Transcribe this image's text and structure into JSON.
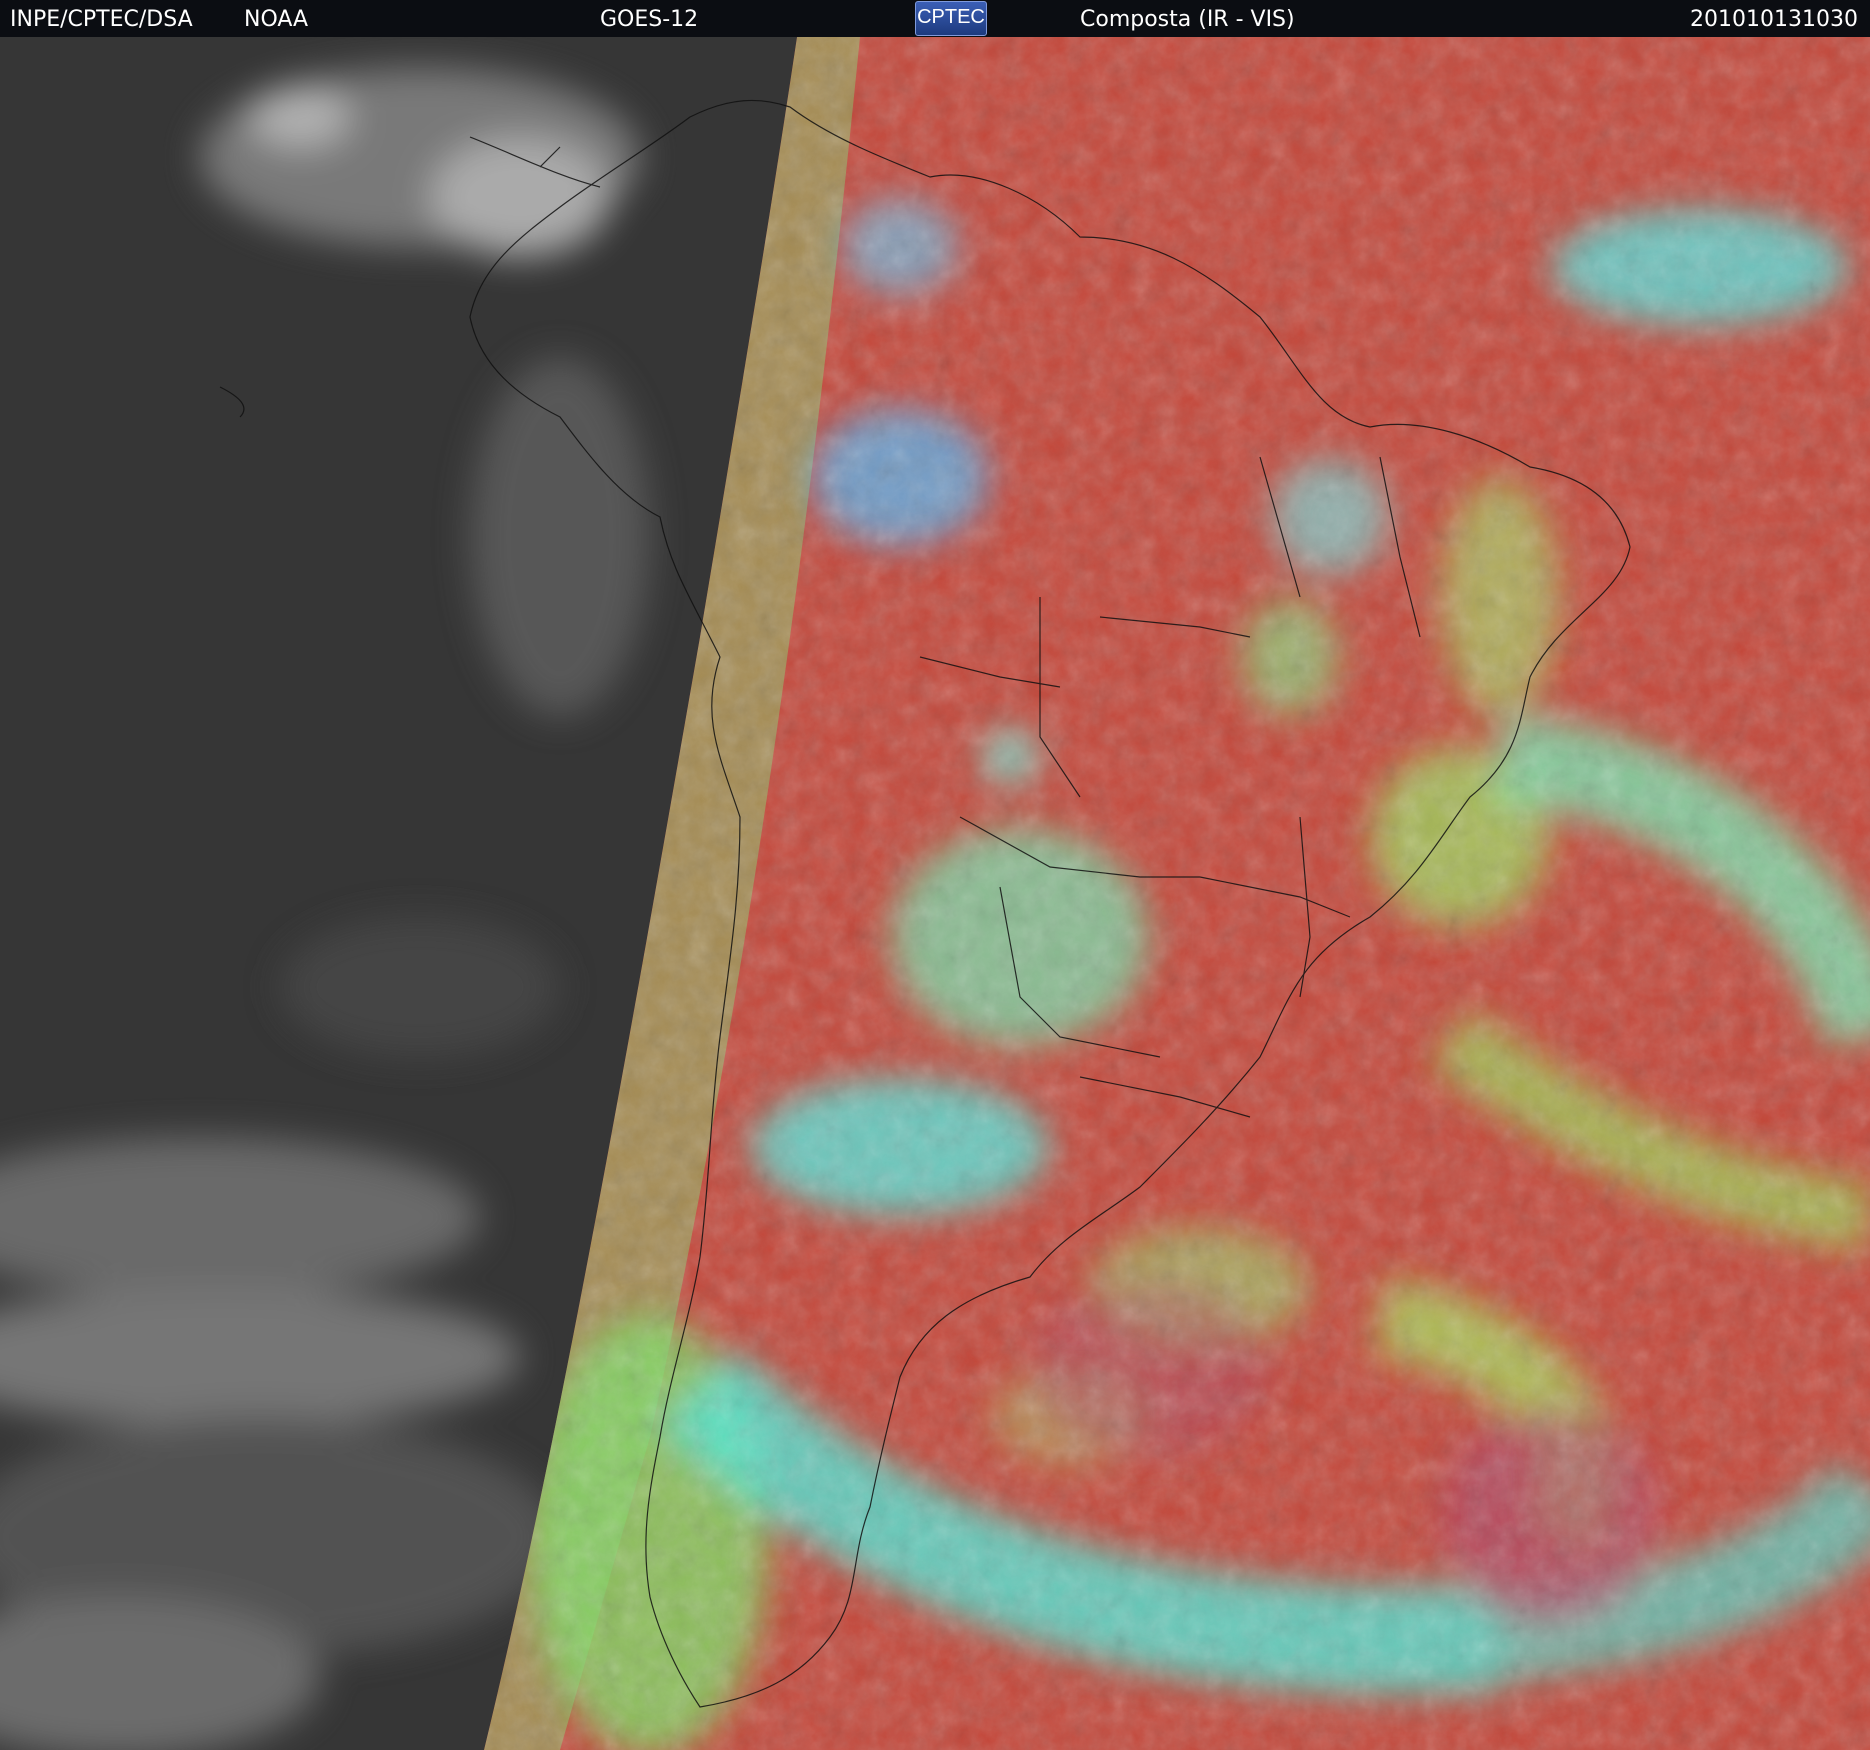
{
  "header": {
    "source": "INPE/CPTEC/DSA",
    "agency": "NOAA",
    "satellite": "GOES-12",
    "logo": "CPTEC",
    "product": "Composta (IR - VIS)",
    "timestamp": "201010131030"
  },
  "colors": {
    "land_clear": "#c0473a",
    "ocean_clear": "#c5503f",
    "cloud_low": "#9ad868",
    "cloud_high": "#4fe8d8",
    "night_dark": "#3a3a3a",
    "night_cloud": "#9a9a9a",
    "coastline": "#111111"
  }
}
